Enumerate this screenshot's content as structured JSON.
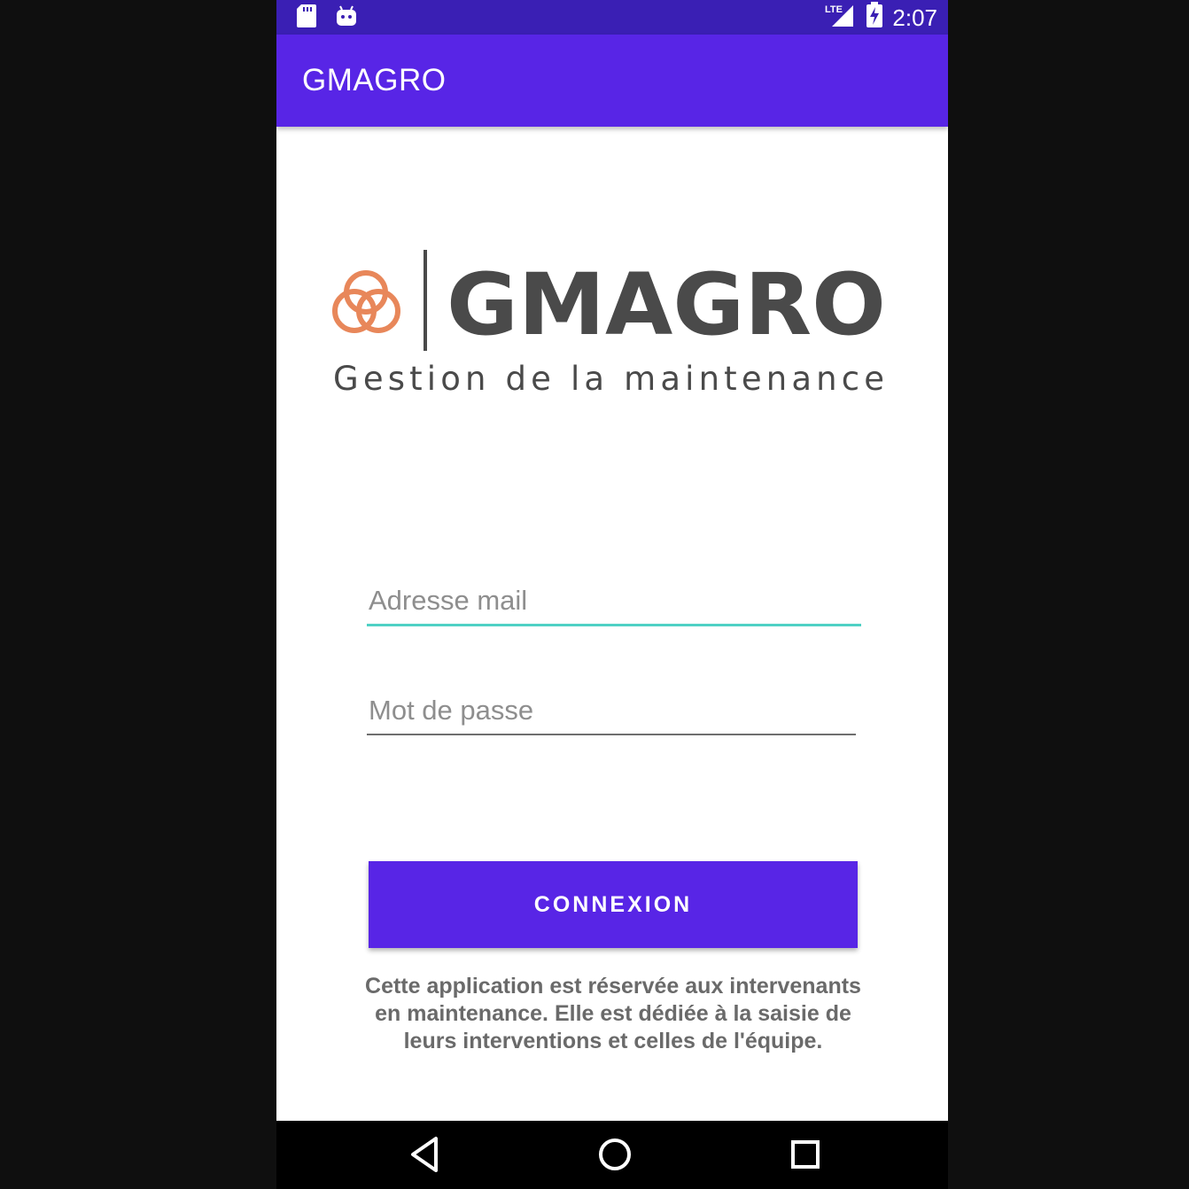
{
  "status_bar": {
    "time": "2:07",
    "network_label": "LTE",
    "left_icons": [
      "sd-card-icon",
      "android-icon"
    ],
    "right_icons": [
      "signal-icon",
      "battery-charging-icon"
    ]
  },
  "app_bar": {
    "title": "GMAGRO",
    "color": "#5825e6"
  },
  "logo": {
    "brand": "GMAGRO",
    "tagline": "Gestion de la maintenance",
    "mark_color": "#e8875a",
    "text_color": "#4a4a4a"
  },
  "login_form": {
    "email_placeholder": "Adresse mail",
    "email_value": "",
    "password_placeholder": "Mot de passe",
    "password_value": "",
    "submit_label": "CONNEXION",
    "accent_color": "#4fd1c5"
  },
  "info_text": "Cette application est réservée aux intervenants en maintenance. Elle est dédiée à la saisie de leurs interventions et celles de l'équipe.",
  "nav_bar": {
    "buttons": [
      "back-icon",
      "home-icon",
      "recents-icon"
    ]
  }
}
